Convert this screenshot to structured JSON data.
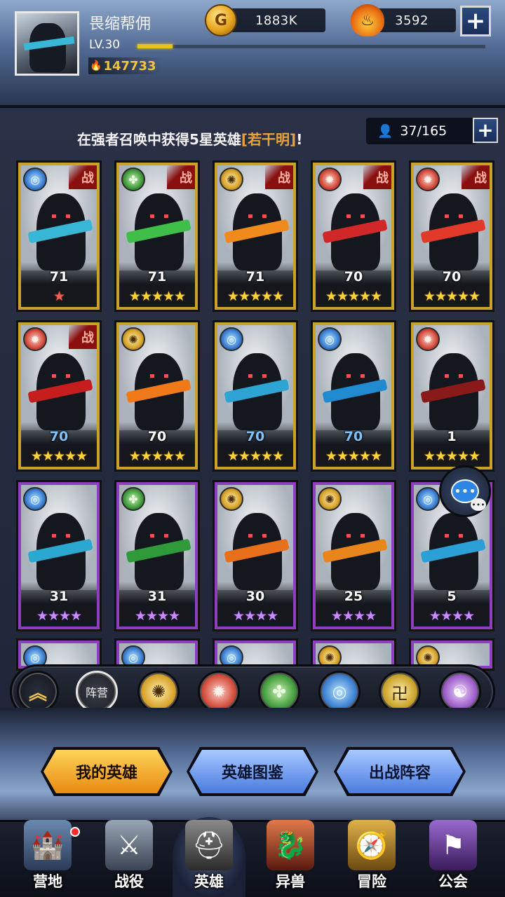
{
  "player": {
    "name": "畏缩帮佣",
    "level": "LV.30",
    "power": "147733",
    "xp_fraction": 0.1
  },
  "resources": {
    "gold": "1883K",
    "gold_icon": "G",
    "gems": "3592"
  },
  "banner": {
    "text_before": "在强者召唤中获得5星英雄",
    "highlight": "[若干明]",
    "text_after": "!"
  },
  "hero_count": "37/165",
  "heroes": [
    {
      "level": "71",
      "stars": "★",
      "star_color": "red",
      "faction": "water",
      "battle": true,
      "accent": "#38b6d6",
      "tier": "gold"
    },
    {
      "level": "71",
      "stars": "★★★★★",
      "faction": "wood",
      "battle": true,
      "accent": "#3fbf4a",
      "tier": "gold"
    },
    {
      "level": "71",
      "stars": "★★★★★",
      "faction": "sun",
      "battle": true,
      "accent": "#f08a1c",
      "tier": "gold"
    },
    {
      "level": "70",
      "stars": "★★★★★",
      "faction": "fire",
      "battle": true,
      "accent": "#d02828",
      "tier": "gold"
    },
    {
      "level": "70",
      "stars": "★★★★★",
      "faction": "fire",
      "battle": true,
      "accent": "#e23a2a",
      "tier": "gold"
    },
    {
      "level": "70",
      "stars": "★★★★★",
      "faction": "fire",
      "battle": true,
      "accent": "#c61e1e",
      "tier": "gold",
      "level_color": "blue"
    },
    {
      "level": "70",
      "stars": "★★★★★",
      "faction": "sun",
      "battle": false,
      "accent": "#f07a1a",
      "tier": "gold"
    },
    {
      "level": "70",
      "stars": "★★★★★",
      "faction": "water",
      "battle": false,
      "accent": "#2ea4d4",
      "tier": "gold",
      "level_color": "blue"
    },
    {
      "level": "70",
      "stars": "★★★★★",
      "faction": "water",
      "battle": false,
      "accent": "#1f8ad0",
      "tier": "gold",
      "level_color": "blue"
    },
    {
      "level": "1",
      "stars": "★★★★★",
      "faction": "fire",
      "battle": false,
      "accent": "#8a1a1a",
      "tier": "gold"
    },
    {
      "level": "31",
      "stars": "★★★★",
      "faction": "water",
      "battle": false,
      "accent": "#2aa8d0",
      "tier": "purple"
    },
    {
      "level": "31",
      "stars": "★★★★",
      "faction": "wood",
      "battle": false,
      "accent": "#2f9a3a",
      "tier": "purple"
    },
    {
      "level": "30",
      "stars": "★★★★",
      "faction": "sun",
      "battle": false,
      "accent": "#e8701a",
      "tier": "purple"
    },
    {
      "level": "25",
      "stars": "★★★★",
      "faction": "sun",
      "battle": false,
      "accent": "#e8861c",
      "tier": "purple"
    },
    {
      "level": "5",
      "stars": "★★★★",
      "faction": "water",
      "battle": false,
      "accent": "#2aa0d6",
      "tier": "purple"
    }
  ],
  "battle_label": "战",
  "faction_glyphs": {
    "water": "◎",
    "wood": "✤",
    "sun": "✺",
    "fire": "✹",
    "earth": "卍",
    "void": "☯"
  },
  "filters": {
    "collapse_icon": "︽",
    "camp_label": "阵营",
    "factions": [
      "sun",
      "fire",
      "wood",
      "water",
      "earth",
      "void"
    ]
  },
  "tabs": {
    "my_heroes": "我的英雄",
    "codex": "英雄图鉴",
    "lineup": "出战阵容"
  },
  "nav": [
    {
      "label": "营地",
      "icon": "castle-icon",
      "glyph": "🏰",
      "dot": true
    },
    {
      "label": "战役",
      "icon": "swords-icon",
      "glyph": "⚔",
      "dot": false
    },
    {
      "label": "英雄",
      "icon": "helmet-icon",
      "glyph": "⛑",
      "dot": false,
      "active": true
    },
    {
      "label": "异兽",
      "icon": "beast-icon",
      "glyph": "🐉",
      "dot": false
    },
    {
      "label": "冒险",
      "icon": "compass-icon",
      "glyph": "🧭",
      "dot": false
    },
    {
      "label": "公会",
      "icon": "guild-banner-icon",
      "glyph": "⚑",
      "dot": false
    }
  ],
  "chat_icon": "•••",
  "chat_icon_small": "•••"
}
